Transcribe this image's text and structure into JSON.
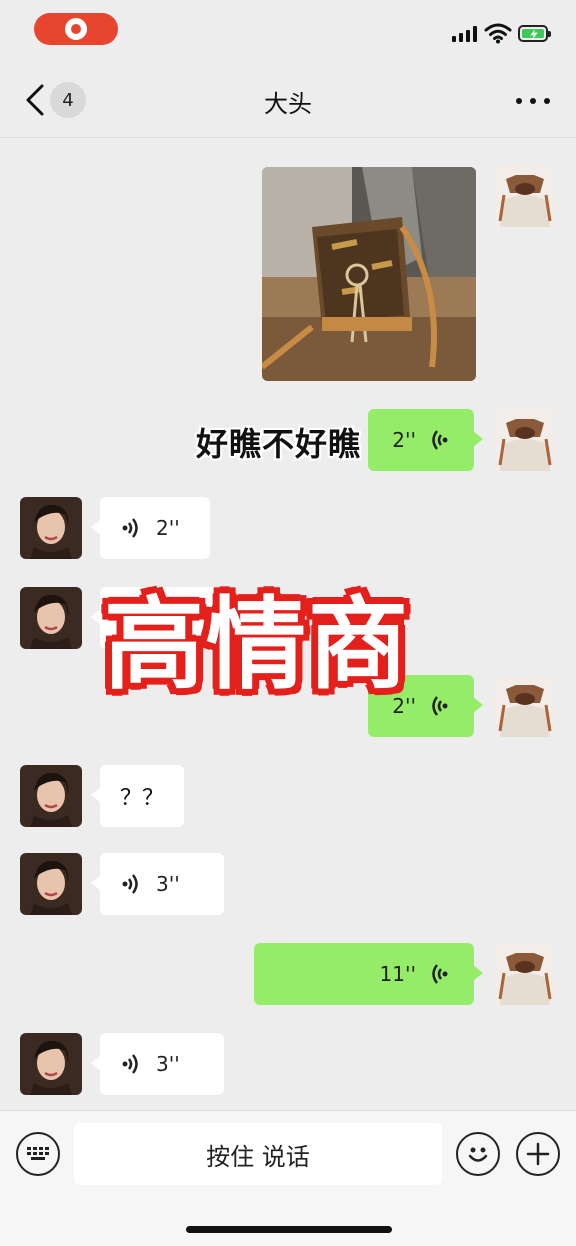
{
  "nav": {
    "title": "大头",
    "unread_count": "4"
  },
  "icons": {
    "record": "screen-record-icon",
    "signal": "signal-icon",
    "wifi": "wifi-icon",
    "battery": "battery-charging-icon",
    "back": "chevron-left-icon",
    "more": "more-dots-icon",
    "voice": "voice-wave-icon",
    "keyboard": "keyboard-icon",
    "emoji": "emoji-icon",
    "plus": "plus-icon"
  },
  "colors": {
    "outgoing_bubble": "#95ec69",
    "incoming_bubble": "#ffffff",
    "record_pill": "#e8452f",
    "caption_outline": "#e3201b"
  },
  "messages": [
    {
      "from": "me",
      "type": "image",
      "content": "handbag photo"
    },
    {
      "from": "me",
      "type": "voice",
      "duration": "2''"
    },
    {
      "from": "other",
      "type": "voice",
      "duration": "2''"
    },
    {
      "from": "other",
      "type": "voice",
      "duration": ""
    },
    {
      "from": "me",
      "type": "voice",
      "duration": "2''"
    },
    {
      "from": "other",
      "type": "text",
      "text": "？？"
    },
    {
      "from": "other",
      "type": "voice",
      "duration": "3''"
    },
    {
      "from": "me",
      "type": "voice",
      "duration": "11''"
    },
    {
      "from": "other",
      "type": "voice",
      "duration": "3''"
    }
  ],
  "captions": {
    "small": "好瞧不好瞧",
    "big": "高情商"
  },
  "input": {
    "hold_to_talk": "按住 说话"
  }
}
